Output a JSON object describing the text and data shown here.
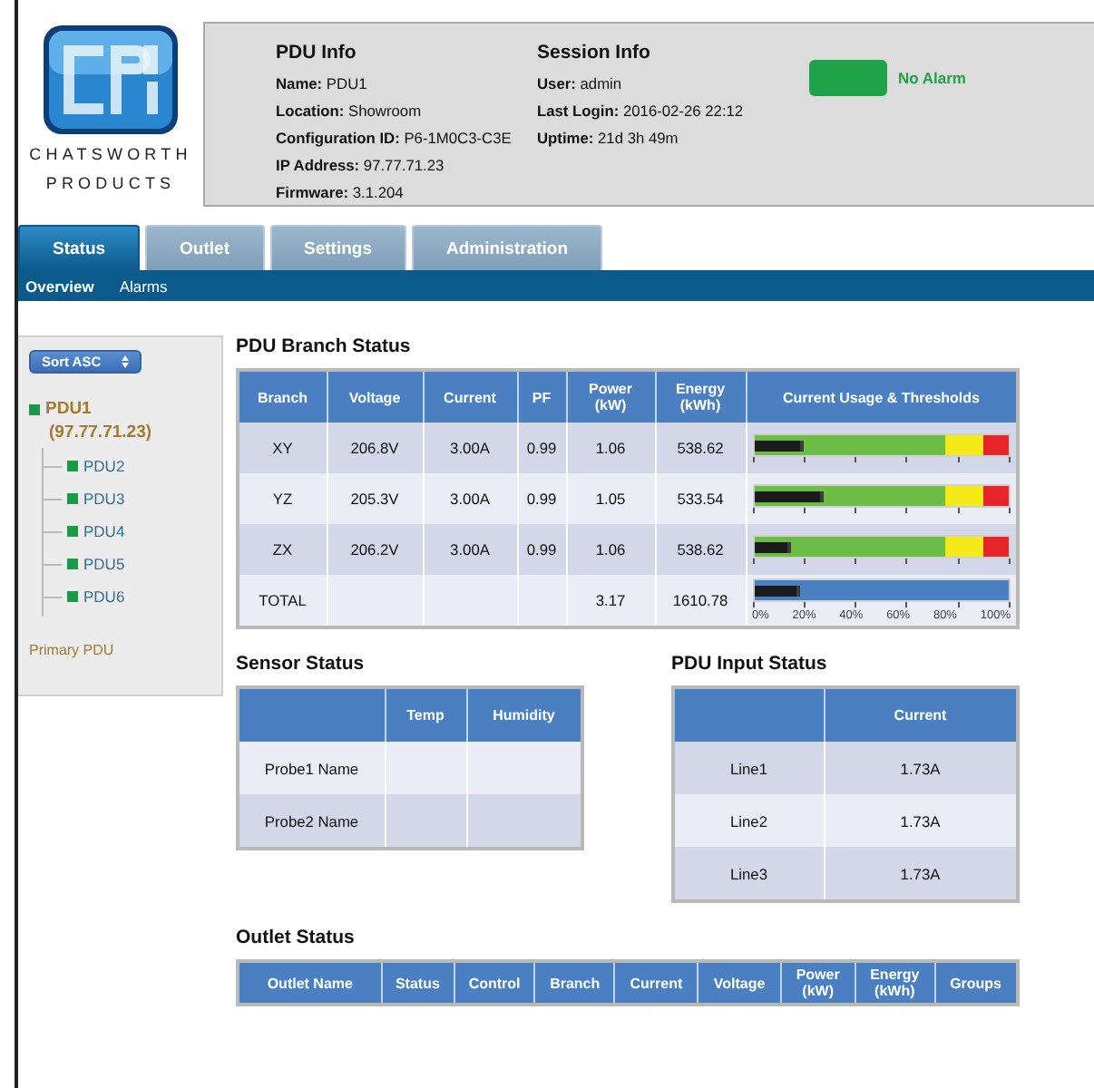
{
  "brand": {
    "lines": [
      "CHATSWORTH",
      "PRODUCTS"
    ]
  },
  "pdu_info": {
    "title": "PDU Info",
    "fields": [
      "**Name:** PDU1",
      "**Location:** Showroom",
      "**Configuration ID:** P6-1M0C3-C3E",
      "**IP Address:** 97.77.71.23",
      "**Firmware:** 3.1.204"
    ]
  },
  "session_info": {
    "title": "Session Info",
    "fields": [
      "**User:** admin",
      "**Last Login:** 2016-02-26 22:12",
      "**Uptime:** 21d 3h 49m"
    ]
  },
  "alarm": {
    "active": false,
    "label": "No Alarm"
  },
  "tabs": [
    {
      "label": "Status",
      "selected": true
    },
    {
      "label": "Outlet",
      "selected": false
    },
    {
      "label": "Settings",
      "selected": false
    },
    {
      "label": "Administration",
      "selected": false
    }
  ],
  "subnav": [
    {
      "label": "Overview",
      "selected": true
    },
    {
      "label": "Alarms",
      "selected": false
    }
  ],
  "sidebar": {
    "sort": "Sort ASC",
    "tree": [
      {
        "label": "PDU1",
        "address": "(97.77.71.23)",
        "color": "#1a9a48",
        "children": [
          {
            "label": "PDU2",
            "color": "#1a9a48"
          },
          {
            "label": "PDU3",
            "color": "#1a9a48"
          },
          {
            "label": "PDU4",
            "color": "#1a9a48"
          },
          {
            "label": "PDU5",
            "color": "#1a9a48"
          },
          {
            "label": "PDU6",
            "color": "#1a9a48"
          }
        ]
      }
    ],
    "legend": "Primary PDU"
  },
  "branch_status": {
    "title": "PDU Branch Status",
    "columns": [
      "Branch",
      "Voltage",
      "Current",
      "PF",
      "Power (kW)",
      "Energy (kWh)",
      "Current Usage & Thresholds"
    ],
    "rows": [
      {
        "kind": "branch",
        "cells": [
          "XY",
          "206.8V",
          "3.00A",
          "0.99",
          "1.06",
          "538.62"
        ],
        "level": 0.18
      },
      {
        "kind": "branch",
        "cells": [
          "YZ",
          "205.3V",
          "3.00A",
          "0.99",
          "1.05",
          "533.54"
        ],
        "level": 0.26
      },
      {
        "kind": "branch",
        "cells": [
          "ZX",
          "206.2V",
          "3.00A",
          "0.99",
          "1.06",
          "538.62"
        ],
        "level": 0.13
      },
      {
        "kind": "total",
        "cells": [
          "TOTAL",
          "",
          "",
          "",
          "3.17",
          "1610.78"
        ],
        "level": 0.17
      }
    ],
    "scale_labels": [
      "0%",
      "20%",
      "40%",
      "60%",
      "80%",
      "100%"
    ]
  },
  "sensor_status": {
    "title": "Sensor Status",
    "columns": [
      "Temp",
      "Humidity"
    ],
    "rows": [
      {
        "name": "Probe1 Name"
      },
      {
        "name": "Probe2 Name"
      }
    ]
  },
  "input_status": {
    "title": "PDU Input Status",
    "columns": [
      "Current"
    ],
    "rows": [
      {
        "line": "Line1",
        "current": "1.73A"
      },
      {
        "line": "Line2",
        "current": "1.73A"
      },
      {
        "line": "Line3",
        "current": "1.73A"
      }
    ]
  },
  "outlet_status": {
    "title": "Outlet Status",
    "columns": [
      "Outlet Name",
      "Status",
      "Control",
      "Branch",
      "Current",
      "Voltage",
      "Power (kW)",
      "Energy (kWh)",
      "Groups"
    ]
  }
}
